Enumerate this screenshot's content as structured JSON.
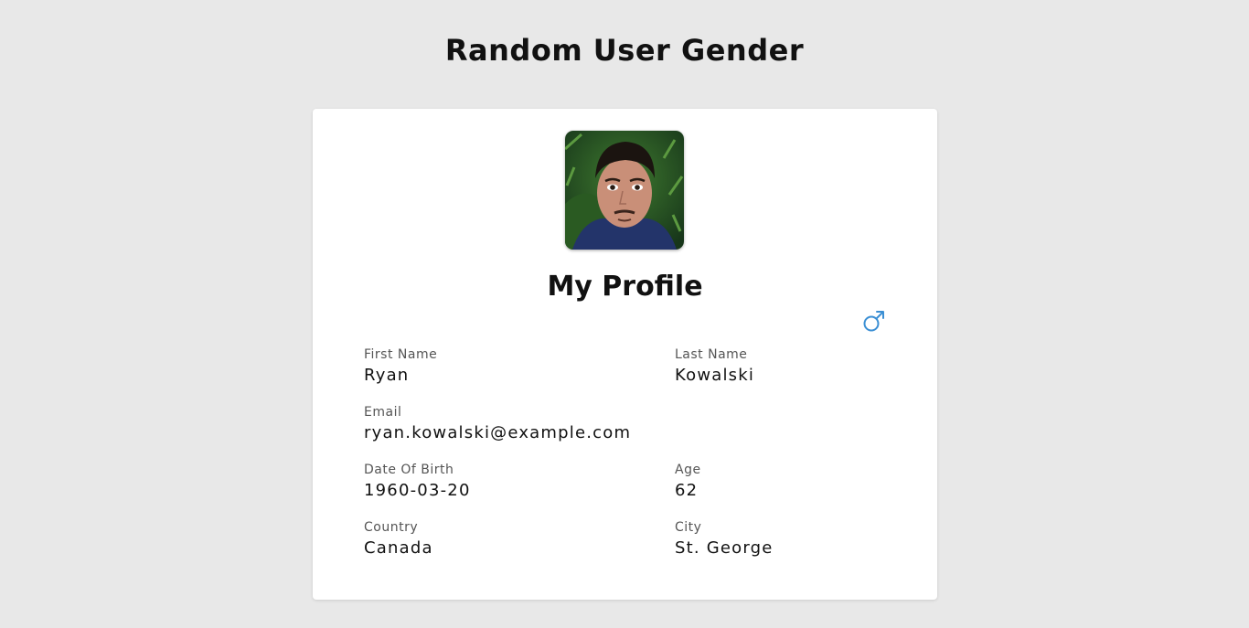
{
  "page": {
    "title": "Random User Gender"
  },
  "profile": {
    "heading": "My Profile",
    "avatar_icon": "user-photo",
    "gender_icon": "male-symbol-icon",
    "accent_color": "#3b8fd4",
    "fields": {
      "first_name": {
        "label": "First Name",
        "value": "Ryan"
      },
      "last_name": {
        "label": "Last Name",
        "value": "Kowalski"
      },
      "email": {
        "label": "Email",
        "value": "ryan.kowalski@example.com"
      },
      "dob": {
        "label": "Date Of Birth",
        "value": "1960-03-20"
      },
      "age": {
        "label": "Age",
        "value": "62"
      },
      "country": {
        "label": "Country",
        "value": "Canada"
      },
      "city": {
        "label": "City",
        "value": "St. George"
      }
    }
  }
}
